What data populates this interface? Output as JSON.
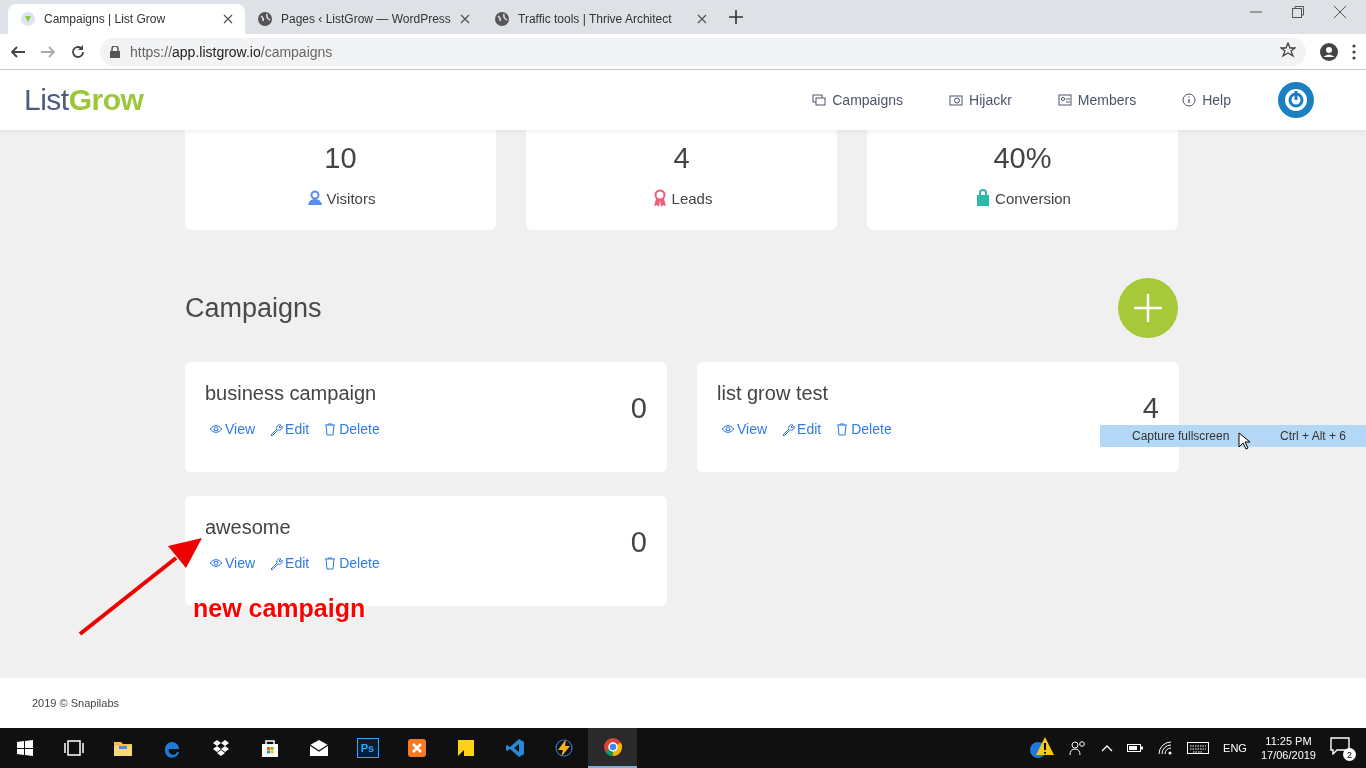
{
  "browser": {
    "tabs": [
      {
        "title": "Campaigns | List Grow",
        "kind": "app",
        "selected": true
      },
      {
        "title": "Pages ‹ ListGrow — WordPress",
        "kind": "globe",
        "selected": false
      },
      {
        "title": "Traffic tools | Thrive Architect",
        "kind": "globe",
        "selected": false
      }
    ],
    "url": {
      "scheme": "https://",
      "host": "app.listgrow.io",
      "path": "/campaigns"
    }
  },
  "header": {
    "logo": {
      "first": "List",
      "second": "Grow"
    },
    "nav": [
      {
        "label": "Campaigns",
        "kind": "stack"
      },
      {
        "label": "Hijackr",
        "kind": "camera"
      },
      {
        "label": "Members",
        "kind": "card"
      },
      {
        "label": "Help",
        "kind": "info"
      }
    ]
  },
  "stats": [
    {
      "value": "10",
      "label": "Visitors",
      "kind": "users",
      "color": "#5b8def"
    },
    {
      "value": "4",
      "label": "Leads",
      "kind": "ribbon",
      "color": "#ef5b7b"
    },
    {
      "value": "40%",
      "label": "Conversion",
      "kind": "bag",
      "color": "#2bbbad"
    }
  ],
  "campaigns": {
    "title": "Campaigns",
    "cards": [
      {
        "name": "business campaign",
        "count": "0",
        "actions": [
          {
            "label": "View",
            "kind": "eye"
          },
          {
            "label": "Edit",
            "kind": "wrench"
          },
          {
            "label": "Delete",
            "kind": "trash"
          }
        ]
      },
      {
        "name": "list grow test",
        "count": "4",
        "actions": [
          {
            "label": "View",
            "kind": "eye"
          },
          {
            "label": "Edit",
            "kind": "wrench"
          },
          {
            "label": "Delete",
            "kind": "trash"
          }
        ]
      },
      {
        "name": "awesome",
        "count": "0",
        "actions": [
          {
            "label": "View",
            "kind": "eye"
          },
          {
            "label": "Edit",
            "kind": "wrench"
          },
          {
            "label": "Delete",
            "kind": "trash"
          }
        ]
      }
    ]
  },
  "annotation": {
    "label": "new campaign"
  },
  "tooltip": {
    "label": "Capture fullscreen",
    "shortcut": "Ctrl + Alt + 6"
  },
  "footer": {
    "text": "2019 © Snapilabs"
  },
  "taskbar": {
    "apps": [
      {
        "kind": "taskview",
        "active": false
      },
      {
        "kind": "folder",
        "active": false
      },
      {
        "kind": "edge",
        "active": false
      },
      {
        "kind": "dropbox",
        "active": false
      },
      {
        "kind": "store",
        "active": false
      },
      {
        "kind": "mail",
        "active": false
      },
      {
        "kind": "photoshop",
        "label": "Ps",
        "active": false
      },
      {
        "kind": "xampp",
        "active": false
      },
      {
        "kind": "notes",
        "active": false
      },
      {
        "kind": "vscode",
        "active": false
      },
      {
        "kind": "bolt",
        "active": false
      },
      {
        "kind": "chrome",
        "active": true
      }
    ],
    "language": "ENG",
    "time": "11:25 PM",
    "date": "17/06/2019",
    "notifications": "2"
  }
}
